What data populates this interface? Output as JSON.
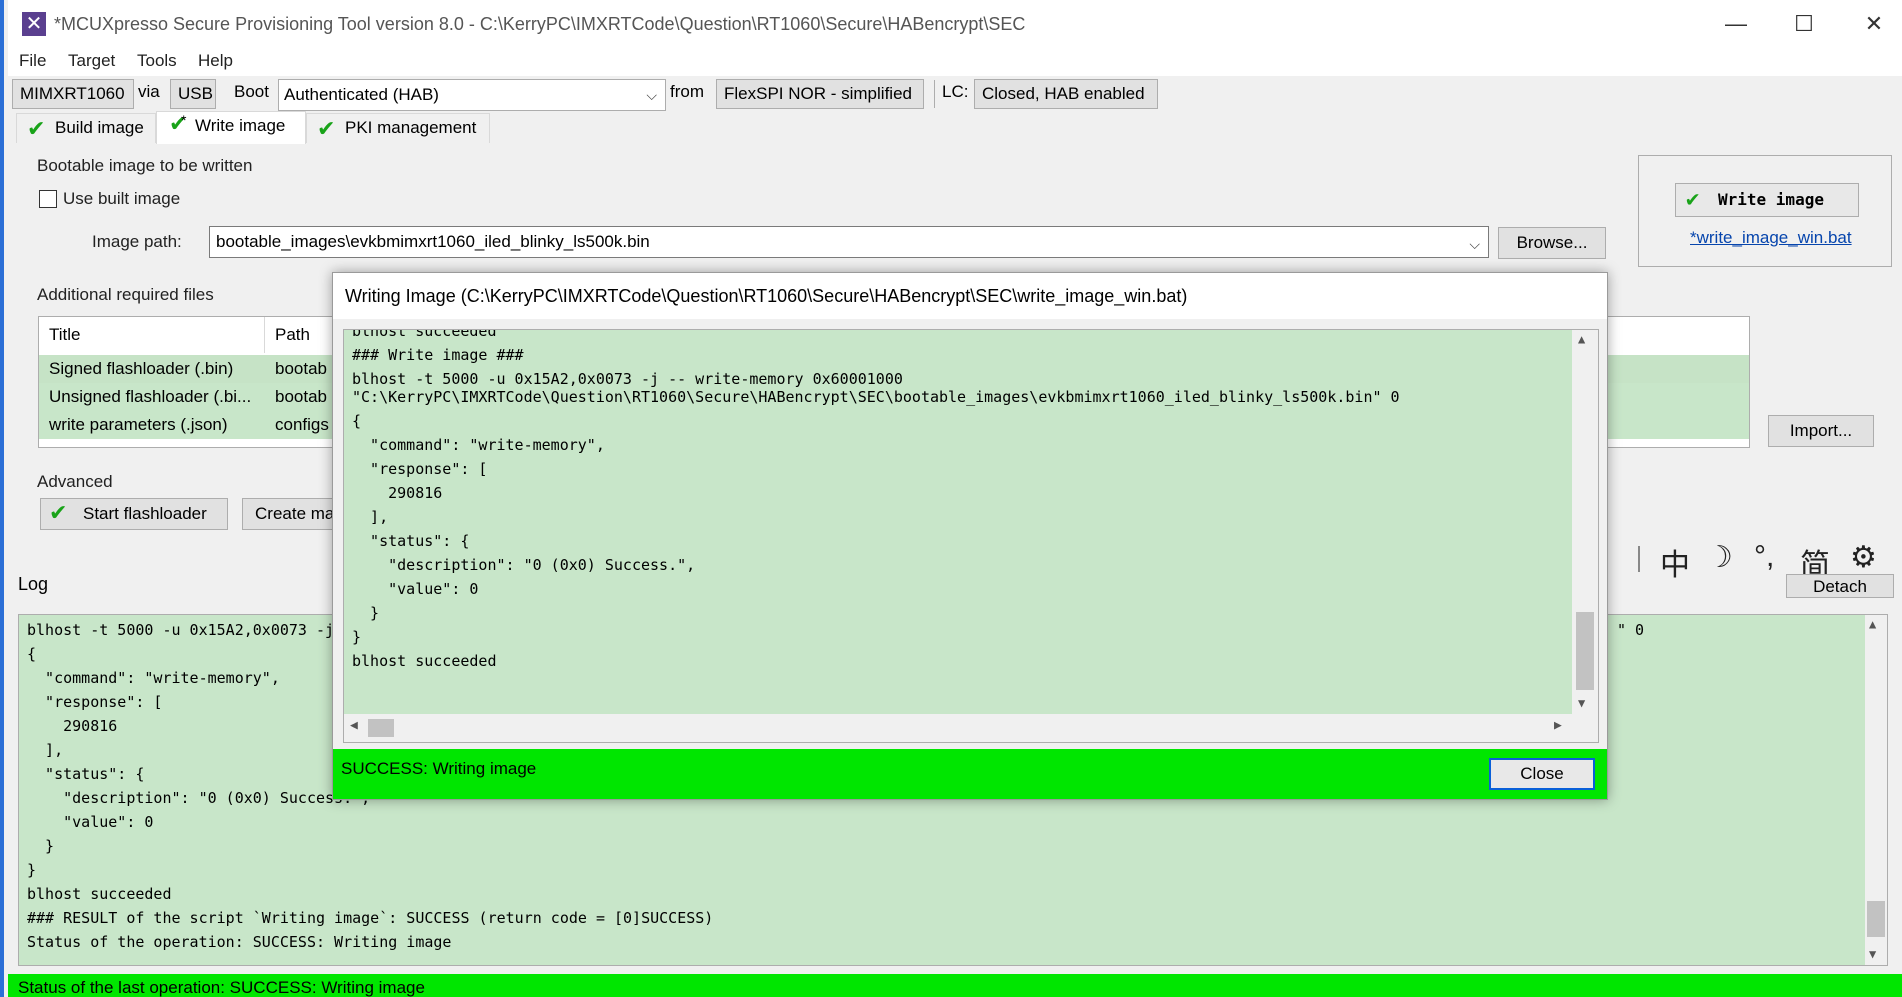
{
  "window": {
    "title": "*MCUXpresso Secure Provisioning Tool version 8.0 - C:\\KerryPC\\IMXRTCode\\Question\\RT1060\\Secure\\HABencrypt\\SEC",
    "minimize": "—",
    "maximize": "☐",
    "close": "✕"
  },
  "menu": [
    "File",
    "Target",
    "Tools",
    "Help"
  ],
  "config": {
    "device": "MIMXRT1060",
    "via_label": "via",
    "connection": "USB",
    "boot_label": "Boot",
    "boot_type": "Authenticated (HAB)",
    "from_label": "from",
    "boot_memory": "FlexSPI NOR - simplified",
    "lc_label": "LC:",
    "lifecycle": "Closed, HAB enabled"
  },
  "tabs": [
    {
      "label": "Build image"
    },
    {
      "label": "Write image",
      "modified": "*"
    },
    {
      "label": "PKI management"
    }
  ],
  "bootable": {
    "group_title": "Bootable image to be written",
    "use_built_label": "Use built image",
    "image_path_label": "Image path:",
    "image_path_value": "bootable_images\\evkbmimxrt1060_iled_blinky_ls500k.bin",
    "browse_label": "Browse..."
  },
  "additional": {
    "group_title": "Additional required files",
    "columns": [
      "Title",
      "Path"
    ],
    "rows": [
      {
        "title": "Signed flashloader (.bin)",
        "path": "bootab"
      },
      {
        "title": "Unsigned flashloader (.bi...",
        "path": "bootab"
      },
      {
        "title": "write parameters (.json)",
        "path": "configs"
      }
    ],
    "import_label": "Import..."
  },
  "advanced": {
    "group_title": "Advanced",
    "start_flashloader_label": "Start flashloader",
    "create_label": "Create ma"
  },
  "write_panel": {
    "write_button_label": "Write image",
    "script_link": "*write_image_win.bat"
  },
  "log": {
    "label": "Log",
    "detach_label": "Detach",
    "side_fragment": "\" 0",
    "lines": [
      "blhost -t 5000 -u 0x15A2,0x0073 -j",
      "{",
      "  \"command\": \"write-memory\",",
      "  \"response\": [",
      "    290816",
      "  ],",
      "  \"status\": {",
      "    \"description\": \"0 (0x0) Success.\",",
      "    \"value\": 0",
      "  }",
      "}",
      "blhost succeeded",
      "### RESULT of the script `Writing image`: SUCCESS (return code = [0]SUCCESS)",
      "Status of the operation: SUCCESS: Writing image"
    ]
  },
  "ime": {
    "lang": "中",
    "mode": "☽",
    "punct": "°,",
    "simp": "简",
    "settings": "⚙"
  },
  "statusbar": "Status of the last operation: SUCCESS: Writing image",
  "dialog": {
    "title": "Writing Image (C:\\KerryPC\\IMXRTCode\\Question\\RT1060\\Secure\\HABencrypt\\SEC\\write_image_win.bat)",
    "lines": [
      "blhost succeeded",
      "### Write image ###",
      "blhost -t 5000 -u 0x15A2,0x0073 -j -- write-memory 0x60001000",
      "\"C:\\KerryPC\\IMXRTCode\\Question\\RT1060\\Secure\\HABencrypt\\SEC\\bootable_images\\evkbmimxrt1060_iled_blinky_ls500k.bin\" 0",
      "{",
      "  \"command\": \"write-memory\",",
      "  \"response\": [",
      "    290816",
      "  ],",
      "  \"status\": {",
      "    \"description\": \"0 (0x0) Success.\",",
      "    \"value\": 0",
      "  }",
      "}",
      "blhost succeeded"
    ],
    "status_text": "SUCCESS: Writing image",
    "close_label": "Close"
  }
}
